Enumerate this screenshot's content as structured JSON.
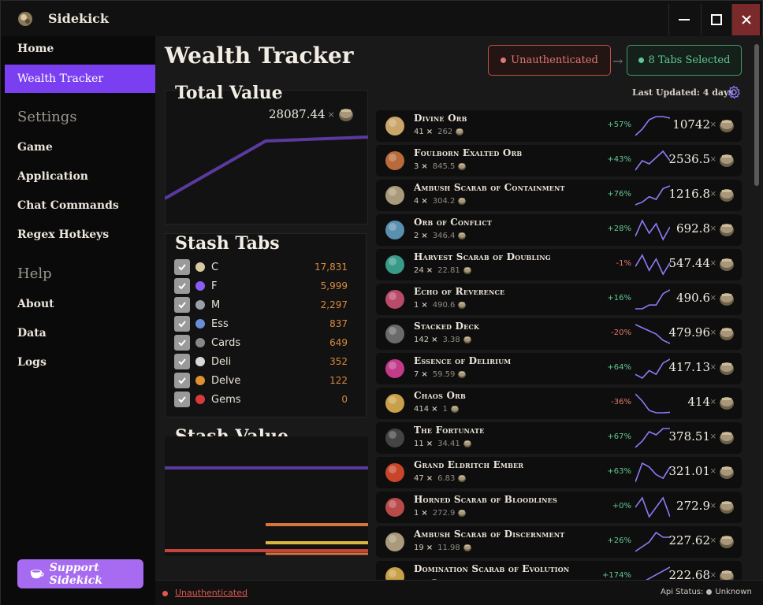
{
  "app": {
    "title": "Sidekick"
  },
  "window": {
    "minimize": "—",
    "maximize": "☐",
    "close": "✕"
  },
  "sidebar": {
    "items": [
      {
        "label": "Home"
      },
      {
        "label": "Wealth Tracker"
      },
      {
        "label": "Game"
      },
      {
        "label": "Application"
      },
      {
        "label": "Chat Commands"
      },
      {
        "label": "Regex Hotkeys"
      },
      {
        "label": "About"
      },
      {
        "label": "Data"
      },
      {
        "label": "Logs"
      }
    ],
    "headers": {
      "settings": "Settings",
      "help": "Help"
    },
    "support_label": "Support Sidekick"
  },
  "header": {
    "title": "Wealth Tracker",
    "auth_label": "Unauthenticated",
    "tabs_label": "8 Tabs Selected",
    "arrow": "→",
    "last_updated": "Last Updated: 4 days"
  },
  "total_value": {
    "title": "Total Value",
    "value": "28087.44",
    "times": "×"
  },
  "stash_tabs": {
    "title": "Stash Tabs",
    "tabs": [
      {
        "name": "C",
        "value": "17,831",
        "icon": "coin-icon"
      },
      {
        "name": "F",
        "value": "5,999",
        "icon": "shield-icon"
      },
      {
        "name": "M",
        "value": "2,297",
        "icon": "map-icon"
      },
      {
        "name": "Ess",
        "value": "837",
        "icon": "essence-icon"
      },
      {
        "name": "Cards",
        "value": "649",
        "icon": "card-icon"
      },
      {
        "name": "Deli",
        "value": "352",
        "icon": "skull-icon"
      },
      {
        "name": "Delve",
        "value": "122",
        "icon": "fossil-icon"
      },
      {
        "name": "Gems",
        "value": "0",
        "icon": "gem-icon"
      }
    ]
  },
  "stash_value": {
    "title": "Stash Value"
  },
  "items": [
    {
      "name": "Divine Orb",
      "qty": "41",
      "unit": "262",
      "change": "+57%",
      "price": "10742",
      "trend": "up",
      "spark": [
        2,
        4,
        7,
        8,
        8,
        7.5
      ],
      "icon": "divine-orb-icon",
      "color": "#caa56a"
    },
    {
      "name": "Foulborn Exalted Orb",
      "qty": "3",
      "unit": "845.5",
      "change": "+43%",
      "price": "2536.5",
      "trend": "up",
      "spark": [
        2,
        5,
        4,
        6,
        8,
        5
      ],
      "icon": "exalted-orb-icon",
      "color": "#b86a3a"
    },
    {
      "name": "Ambush Scarab of Containment",
      "qty": "4",
      "unit": "304.2",
      "change": "+76%",
      "price": "1216.8",
      "trend": "up",
      "spark": [
        1,
        2,
        4,
        3,
        7,
        8
      ],
      "icon": "scarab-icon",
      "color": "#a89a7a"
    },
    {
      "name": "Orb of Conflict",
      "qty": "2",
      "unit": "346.4",
      "change": "+28%",
      "price": "692.8",
      "trend": "up",
      "spark": [
        3,
        8,
        4,
        7,
        2,
        6
      ],
      "icon": "conflict-orb-icon",
      "color": "#5a8fb0"
    },
    {
      "name": "Harvest Scarab of Doubling",
      "qty": "24",
      "unit": "22.81",
      "change": "-1%",
      "price": "547.44",
      "trend": "down",
      "spark": [
        5,
        8,
        4,
        7,
        3,
        6
      ],
      "icon": "harvest-scarab-icon",
      "color": "#3a9a8a"
    },
    {
      "name": "Echo of Reverence",
      "qty": "1",
      "unit": "490.6",
      "change": "+16%",
      "price": "490.6",
      "trend": "up",
      "spark": [
        2,
        2,
        3,
        3,
        6,
        7
      ],
      "icon": "echo-icon",
      "color": "#b84a6a"
    },
    {
      "name": "Stacked Deck",
      "qty": "142",
      "unit": "3.38",
      "change": "-20%",
      "price": "479.96",
      "trend": "down",
      "spark": [
        8,
        7,
        6,
        5,
        3,
        2
      ],
      "icon": "deck-icon",
      "color": "#6a6a6a"
    },
    {
      "name": "Essence of Delirium",
      "qty": "7",
      "unit": "59.59",
      "change": "+64%",
      "price": "417.13",
      "trend": "up",
      "spark": [
        3,
        2,
        4,
        3,
        6,
        7
      ],
      "icon": "essence-delirium-icon",
      "color": "#c23a8a"
    },
    {
      "name": "Chaos Orb",
      "qty": "414",
      "unit": "1",
      "change": "-36%",
      "price": "414",
      "trend": "down",
      "spark": [
        9,
        6,
        2,
        1,
        1,
        1.2
      ],
      "icon": "chaos-orb-icon",
      "color": "#c9a04a"
    },
    {
      "name": "The Fortunate",
      "qty": "11",
      "unit": "34.41",
      "change": "+67%",
      "price": "378.51",
      "trend": "up",
      "spark": [
        1,
        3,
        6,
        5,
        7,
        7
      ],
      "icon": "card-icon",
      "color": "#444"
    },
    {
      "name": "Grand Eldritch Ember",
      "qty": "47",
      "unit": "6.83",
      "change": "+63%",
      "price": "321.01",
      "trend": "up",
      "spark": [
        2,
        7,
        6,
        4,
        3,
        6
      ],
      "icon": "ember-icon",
      "color": "#c8452a"
    },
    {
      "name": "Horned Scarab of Bloodlines",
      "qty": "1",
      "unit": "272.9",
      "change": "+0%",
      "price": "272.9",
      "trend": "flat",
      "spark": [
        5,
        6,
        4,
        5,
        6,
        4
      ],
      "icon": "horned-scarab-icon",
      "color": "#b84a4a"
    },
    {
      "name": "Ambush Scarab of Discernment",
      "qty": "19",
      "unit": "11.98",
      "change": "+26%",
      "price": "227.62",
      "trend": "up",
      "spark": [
        2,
        3,
        4,
        6,
        5,
        5
      ],
      "icon": "scarab-icon",
      "color": "#a89a7a"
    },
    {
      "name": "Domination Scarab of Evolution",
      "qty": "",
      "unit": "",
      "change": "+174%",
      "price": "222.68",
      "trend": "up",
      "spark": [
        2,
        3,
        4,
        5,
        6,
        7
      ],
      "icon": "domination-scarab-icon",
      "color": "#c9a04a"
    }
  ],
  "times": "×",
  "status": {
    "auth": "Unauthenticated",
    "api_label": "Api Status:",
    "api_value": "Unknown"
  },
  "colors": {
    "accent": "#7b3ff2",
    "support": "#a66bf0",
    "up": "#5fc792",
    "down": "#e0786e",
    "spark": "#8b7cf6",
    "tab_value": "#d9893c",
    "total_line": "#5b3aa0"
  }
}
